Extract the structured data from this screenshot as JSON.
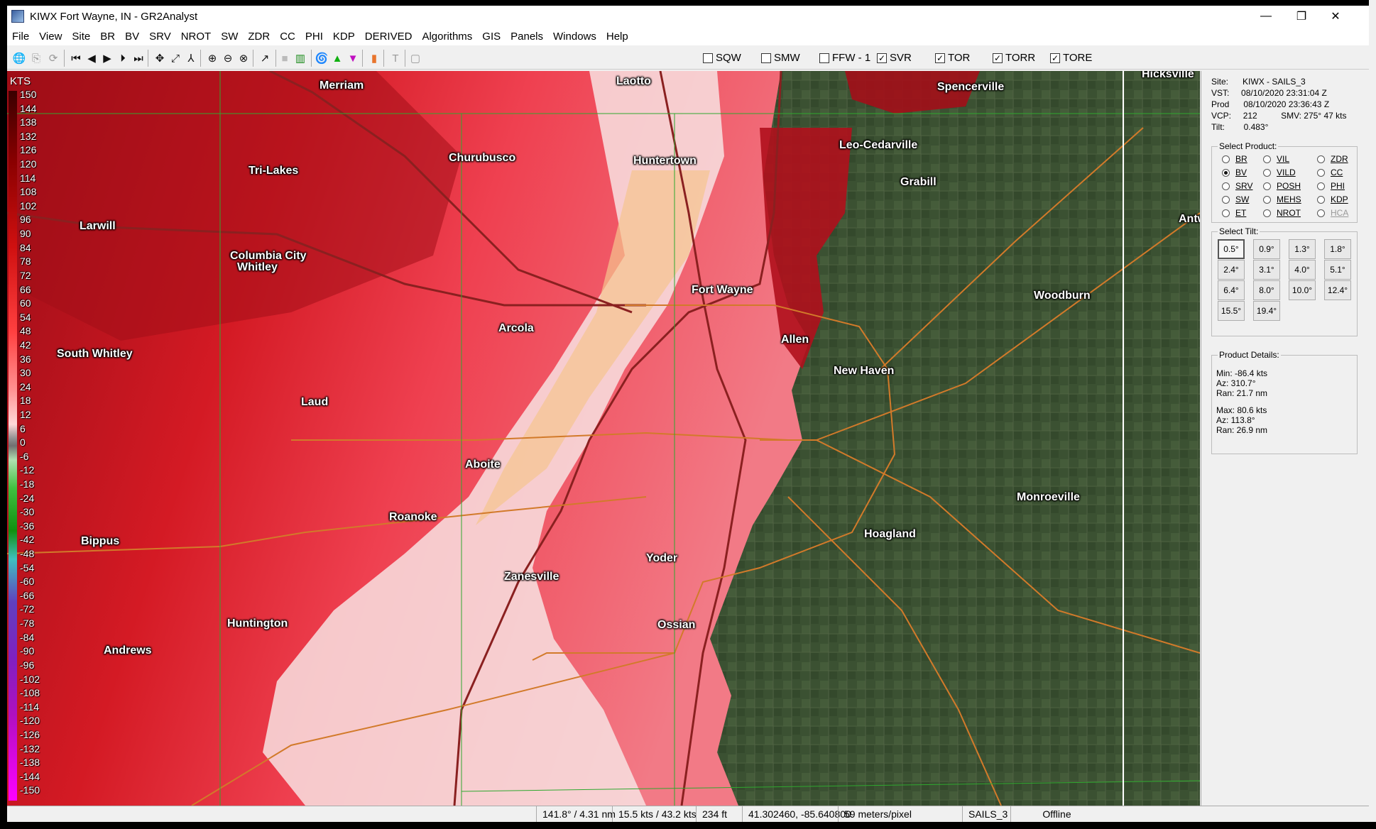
{
  "window": {
    "title": "KIWX Fort Wayne, IN - GR2Analyst",
    "minimize": "—",
    "restore": "❐",
    "close": "✕"
  },
  "menu": [
    "File",
    "View",
    "Site",
    "BR",
    "BV",
    "SRV",
    "NROT",
    "SW",
    "ZDR",
    "CC",
    "PHI",
    "KDP",
    "DERIVED",
    "Algorithms",
    "GIS",
    "Panels",
    "Windows",
    "Help"
  ],
  "warnings": [
    {
      "label": "SQW",
      "checked": false
    },
    {
      "label": "SMW",
      "checked": false
    },
    {
      "label": "FFW - 1",
      "checked": false
    },
    {
      "label": "SVR",
      "checked": true
    },
    {
      "label": "TOR",
      "checked": true
    },
    {
      "label": "TORR",
      "checked": true
    },
    {
      "label": "TORE",
      "checked": true
    }
  ],
  "legend": {
    "units": "KTS",
    "labels": [
      "150",
      "144",
      "138",
      "132",
      "126",
      "120",
      "114",
      "108",
      "102",
      "96",
      "90",
      "84",
      "78",
      "72",
      "66",
      "60",
      "54",
      "48",
      "42",
      "36",
      "30",
      "24",
      "18",
      "12",
      "6",
      "0",
      "-6",
      "-12",
      "-18",
      "-24",
      "-30",
      "-36",
      "-42",
      "-48",
      "-54",
      "-60",
      "-66",
      "-72",
      "-78",
      "-84",
      "-90",
      "-96",
      "-102",
      "-108",
      "-114",
      "-120",
      "-126",
      "-132",
      "-138",
      "-144",
      "-150"
    ]
  },
  "cities": [
    {
      "name": "Merriam"
    },
    {
      "name": "Laotto"
    },
    {
      "name": "Spencerville"
    },
    {
      "name": "Hicksville"
    },
    {
      "name": "Churubusco"
    },
    {
      "name": "Huntertown"
    },
    {
      "name": "Leo-Cedarville"
    },
    {
      "name": "Tri-Lakes"
    },
    {
      "name": "Grabill"
    },
    {
      "name": "Larwill"
    },
    {
      "name": "Antw"
    },
    {
      "name": "Columbia City"
    },
    {
      "name": "Whitley"
    },
    {
      "name": "Fort Wayne"
    },
    {
      "name": "Woodburn"
    },
    {
      "name": "Arcola"
    },
    {
      "name": "Allen"
    },
    {
      "name": "South Whitley"
    },
    {
      "name": "New Haven"
    },
    {
      "name": "Laud"
    },
    {
      "name": "Aboite"
    },
    {
      "name": "Monroeville"
    },
    {
      "name": "Roanoke"
    },
    {
      "name": "Hoagland"
    },
    {
      "name": "Bippus"
    },
    {
      "name": "Yoder"
    },
    {
      "name": "Zanesville"
    },
    {
      "name": "Huntington"
    },
    {
      "name": "Ossian"
    },
    {
      "name": "Andrews"
    }
  ],
  "site_info": {
    "site_label": "Site:",
    "site": "KIWX - SAILS_3",
    "vst_label": "VST:",
    "vst": "08/10/2020  23:31:04 Z",
    "prod_label": "Prod",
    "prod": "08/10/2020  23:36:43 Z",
    "vcp_label": "VCP:",
    "vcp": "212",
    "smv": "SMV:  275° 47 kts",
    "tilt_label": "Tilt:",
    "tilt": "0.483°"
  },
  "select_product": {
    "title": "Select Product:",
    "options": [
      {
        "label": "BR",
        "selected": false,
        "enabled": true
      },
      {
        "label": "VIL",
        "selected": false,
        "enabled": true
      },
      {
        "label": "ZDR",
        "selected": false,
        "enabled": true
      },
      {
        "label": "BV",
        "selected": true,
        "enabled": true
      },
      {
        "label": "VILD",
        "selected": false,
        "enabled": true
      },
      {
        "label": "CC",
        "selected": false,
        "enabled": true
      },
      {
        "label": "SRV",
        "selected": false,
        "enabled": true
      },
      {
        "label": "POSH",
        "selected": false,
        "enabled": true
      },
      {
        "label": "PHI",
        "selected": false,
        "enabled": true
      },
      {
        "label": "SW",
        "selected": false,
        "enabled": true
      },
      {
        "label": "MEHS",
        "selected": false,
        "enabled": true
      },
      {
        "label": "KDP",
        "selected": false,
        "enabled": true
      },
      {
        "label": "ET",
        "selected": false,
        "enabled": true
      },
      {
        "label": "NROT",
        "selected": false,
        "enabled": true
      },
      {
        "label": "HCA",
        "selected": false,
        "enabled": false
      }
    ]
  },
  "select_tilt": {
    "title": "Select Tilt:",
    "options": [
      "0.5°",
      "0.9°",
      "1.3°",
      "1.8°",
      "2.4°",
      "3.1°",
      "4.0°",
      "5.1°",
      "6.4°",
      "8.0°",
      "10.0°",
      "12.4°",
      "15.5°",
      "19.4°"
    ],
    "selected": "0.5°"
  },
  "product_details": {
    "title": "Product Details:",
    "min": "Min:  -86.4 kts",
    "min_az": "Az:  310.7°",
    "min_ran": "Ran:  21.7 nm",
    "max": "Max:  80.6 kts",
    "max_az": "Az:  113.8°",
    "max_ran": "Ran:  26.9 nm"
  },
  "status": {
    "az_range": "141.8° / 4.31 nm",
    "velocity": "15.5 kts / 43.2 kts",
    "height": "234 ft",
    "latlon": "41.302460, -85.640800",
    "scale": "59 meters/pixel",
    "mode": "SAILS_3",
    "connection": "Offline"
  },
  "colors": {
    "inbound_max": "#ff00ff",
    "outbound_max": "#ff0000",
    "map_bg": "#3d5234"
  }
}
